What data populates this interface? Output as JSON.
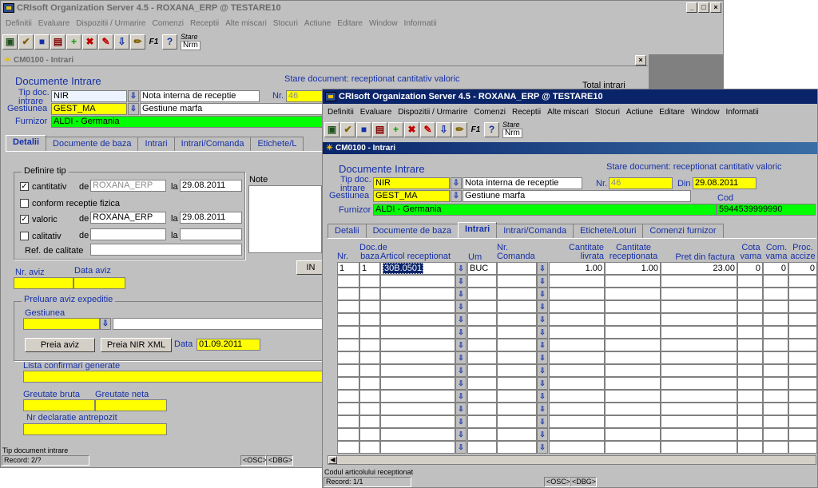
{
  "back": {
    "title": "CRIsoft Organization Server 4.5 - ROXANA_ERP @ TESTARE10",
    "menu": [
      "Definitii",
      "Evaluare",
      "Dispozitii / Urmarire",
      "Comenzi",
      "Receptii",
      "Alte miscari",
      "Stocuri",
      "Actiune",
      "Editare",
      "Window",
      "Informatii"
    ],
    "stare_label": "Stare",
    "stare_value": "Nrm",
    "form_title": "CM0100 - Intrari",
    "section_title": "Documente Intrare",
    "stare_doc_label": "Stare document:",
    "stare_doc_value": "receptionat cantitativ valoric",
    "total_label": "Total intrari",
    "tipdoc_label": "Tip doc. intrare",
    "tipdoc_value": "NIR",
    "tipdoc_desc": "Nota interna de receptie",
    "nr_label": "Nr.",
    "nr_value": "46",
    "gest_label": "Gestiunea",
    "gest_value": "GEST_MA",
    "gest_desc": "Gestiune marfa",
    "furn_label": "Furnizor",
    "furn_value": "ALDI    - Germania",
    "tabs": [
      "Detalii",
      "Documente de baza",
      "Intrari",
      "Intrari/Comanda",
      "Etichete/L"
    ],
    "definire_tip": "Definire tip",
    "cantitativ": "cantitativ",
    "cantitativ_de": "ROXANA_ERP",
    "cantitativ_la": "29.08.2011",
    "conform": "conform receptie fizica",
    "valoric": "valoric",
    "valoric_de": "ROXANA_ERP",
    "valoric_la": "29.08.2011",
    "calitativ": "calitativ",
    "de_label": "de",
    "la_label": "la",
    "ref_calitate": "Ref. de calitate",
    "note_label": "Note",
    "in_button": "IN",
    "nr_aviz": "Nr. aviz",
    "data_aviz": "Data aviz",
    "preluare": "Preluare aviz expeditie",
    "gestiunea": "Gestiunea",
    "preia_aviz": "Preia aviz",
    "preia_nir_xml": "Preia NIR XML",
    "data_label": "Data",
    "data_value": "01.09.2011",
    "lista_conf": "Lista confirmari generate",
    "greutate_bruta": "Greutate bruta",
    "greutate_neta": "Greutate neta",
    "nr_decl": "Nr declaratie antrepozit",
    "status_text": "Tip document intrare",
    "record": "Record: 2/?",
    "osc": "<OSC>",
    "dbg": "<DBG>"
  },
  "front": {
    "title": "CRIsoft Organization Server 4.5 - ROXANA_ERP @ TESTARE10",
    "menu": [
      "Definitii",
      "Evaluare",
      "Dispozitii / Urmarire",
      "Comenzi",
      "Receptii",
      "Alte miscari",
      "Stocuri",
      "Actiune",
      "Editare",
      "Window",
      "Informatii"
    ],
    "stare_label": "Stare",
    "stare_value": "Nrm",
    "form_title": "CM0100 - Intrari",
    "section_title": "Documente Intrare",
    "stare_doc_label": "Stare document:",
    "stare_doc_value": "receptionat cantitativ valoric",
    "tipdoc_label": "Tip doc. intrare",
    "tipdoc_value": "NIR",
    "tipdoc_desc": "Nota interna de receptie",
    "nr_label": "Nr.",
    "nr_value": "46",
    "din_label": "Din",
    "din_value": "29.08.2011",
    "gest_label": "Gestiunea",
    "gest_value": "GEST_MA",
    "gest_desc": "Gestiune marfa",
    "cod_label": "Cod",
    "cod_value": "5944539999990",
    "furn_label": "Furnizor",
    "furn_value": "ALDI    - Germania",
    "tabs": [
      "Detalii",
      "Documente de baza",
      "Intrari",
      "Intrari/Comanda",
      "Etichete/Loturi",
      "Comenzi furnizor"
    ],
    "columns": {
      "nr": "Nr.",
      "doc_baza": "Doc.de baza",
      "articol": "Articol receptionat",
      "um": "Um",
      "nr_comanda": "Nr. Comanda",
      "cant_livrata": "Cantitate livrata",
      "cant_rec": "Cantitate receptionata",
      "pret": "Pret din factura",
      "cota_vama": "Cota vama",
      "com_vama": "Com. vama",
      "proc_accize": "Proc. accize"
    },
    "row1": {
      "nr": "1",
      "doc_baza": "1",
      "articol": "30B.0501",
      "um": "BUC",
      "nr_comanda": "",
      "cant_livrata": "1.00",
      "cant_rec": "1.00",
      "pret": "23.00",
      "cota_vama": "0",
      "com_vama": "0",
      "proc_accize": "0"
    },
    "status_text": "Codul articolului receptionat",
    "record": "Record: 1/1",
    "osc": "<OSC>",
    "dbg": "<DBG>"
  }
}
